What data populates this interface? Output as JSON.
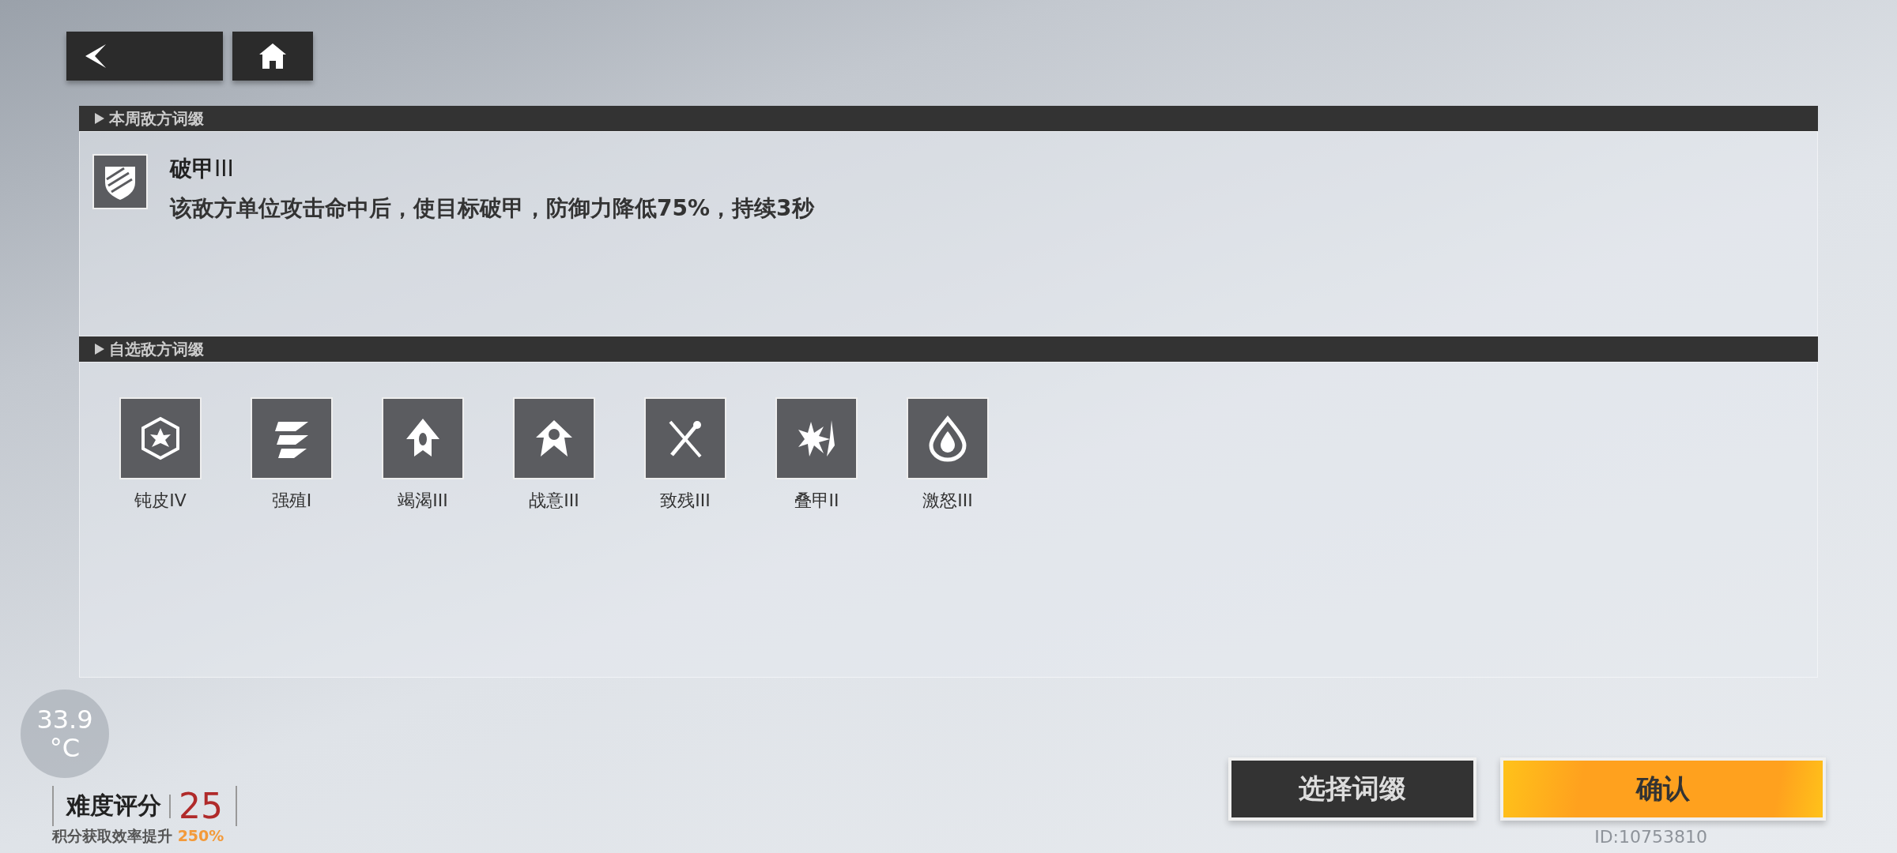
{
  "weekly_section": {
    "title": "本周敌方词缀",
    "affix": {
      "name": "破甲",
      "tier": "III",
      "description": "该敌方单位攻击命中后，使目标破甲，防御力降低75%，持续3秒"
    }
  },
  "optional_section": {
    "title": "自选敌方词缀",
    "affixes": [
      {
        "name": "钝皮",
        "tier": "IV"
      },
      {
        "name": "强殖",
        "tier": "I"
      },
      {
        "name": "竭渴",
        "tier": "III"
      },
      {
        "name": "战意",
        "tier": "III"
      },
      {
        "name": "致残",
        "tier": "III"
      },
      {
        "name": "叠甲",
        "tier": "II"
      },
      {
        "name": "激怒",
        "tier": "III"
      }
    ]
  },
  "temperature": {
    "value": "33.9",
    "unit": "°C"
  },
  "difficulty": {
    "label": "难度评分",
    "score": "25",
    "bonus_label": "积分获取效率提升",
    "bonus_value": "250%"
  },
  "buttons": [
    {
      "kind": "secondary",
      "label": "选择词缀"
    },
    {
      "kind": "primary",
      "label": "确认"
    }
  ],
  "player_id": "ID:10753810"
}
